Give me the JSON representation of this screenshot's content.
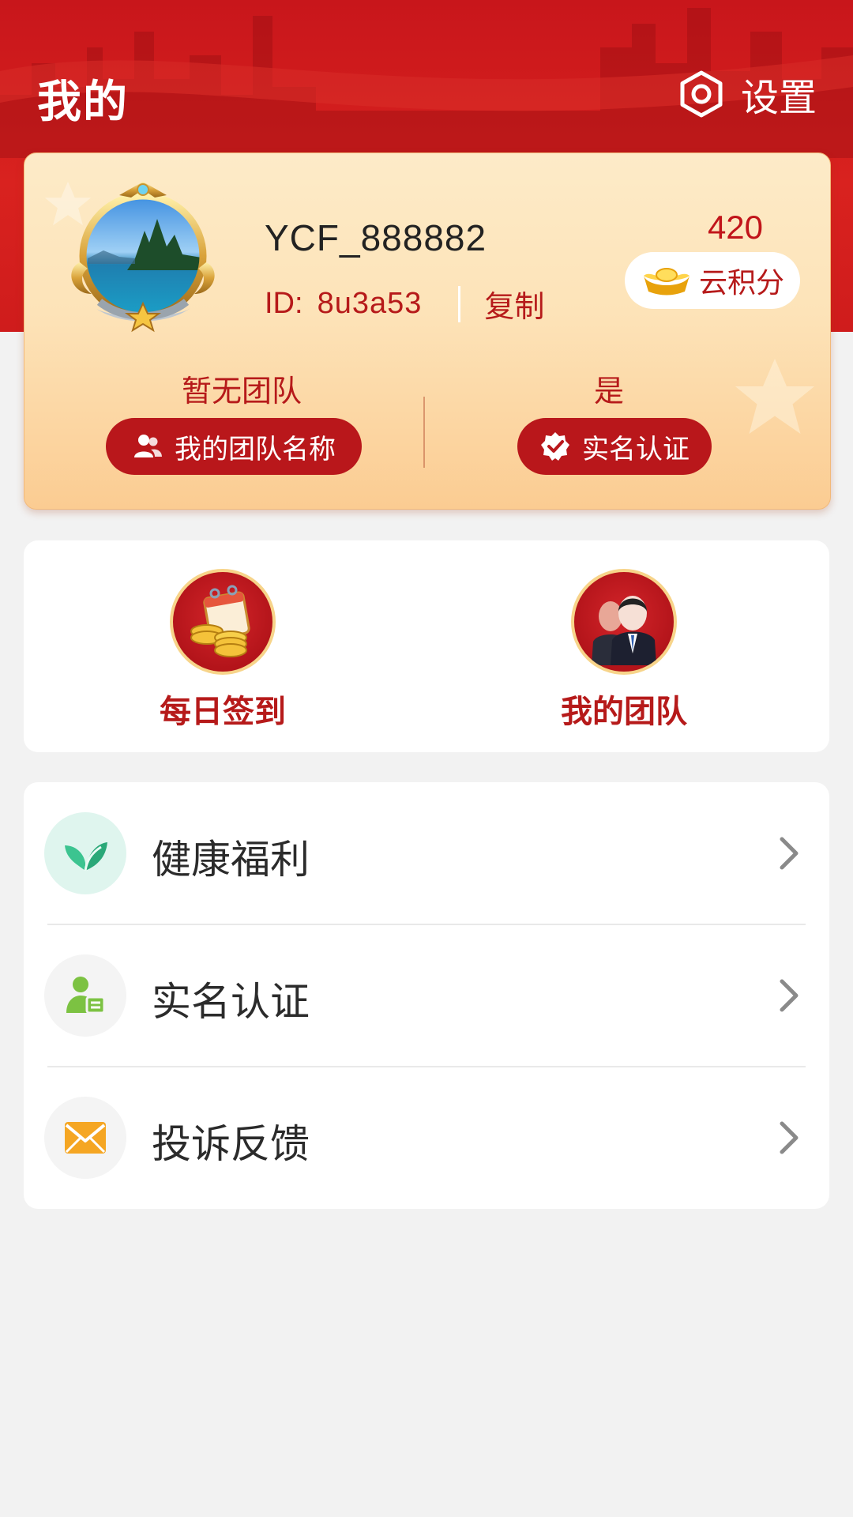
{
  "header": {
    "title": "我的",
    "settings_label": "设置",
    "settings_icon": "hexagon-settings-icon"
  },
  "profile": {
    "username": "YCF_888882",
    "id_label": "ID:",
    "id_value": "8u3a53",
    "copy_label": "复制",
    "points_value": "420",
    "points_label": "云积分",
    "team_status": "暂无团队",
    "team_button": "我的团队名称",
    "realname_status": "是",
    "realname_button": "实名认证"
  },
  "quick_actions": [
    {
      "label": "每日签到",
      "icon": "calendar-coins-icon"
    },
    {
      "label": "我的团队",
      "icon": "team-people-icon"
    }
  ],
  "menu": [
    {
      "label": "健康福利",
      "icon": "leaf-icon",
      "icon_bg": "#dff5ee",
      "icon_color": "#3cc490"
    },
    {
      "label": "实名认证",
      "icon": "id-card-person-icon",
      "icon_bg": "#f4f4f4",
      "icon_color": "#7cc242"
    },
    {
      "label": "投诉反馈",
      "icon": "envelope-icon",
      "icon_bg": "#f4f4f4",
      "icon_color": "#f5a623"
    }
  ],
  "colors": {
    "brand_red": "#c8161b",
    "card_gold": "#fde3b8",
    "text_red": "#b61a1a"
  }
}
